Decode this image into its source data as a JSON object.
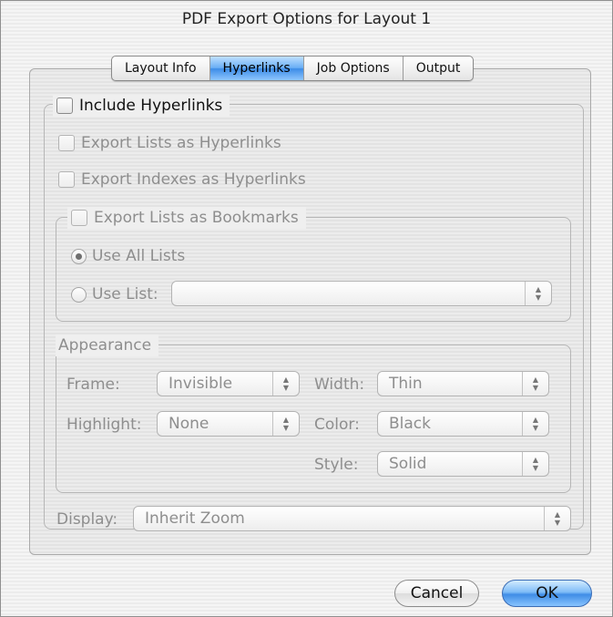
{
  "window": {
    "title": "PDF Export Options for Layout 1"
  },
  "tabs": [
    {
      "label": "Layout Info",
      "active": false
    },
    {
      "label": "Hyperlinks",
      "active": true
    },
    {
      "label": "Job Options",
      "active": false
    },
    {
      "label": "Output",
      "active": false
    }
  ],
  "hyperlinks": {
    "include_label": "Include Hyperlinks",
    "include_checked": false,
    "export_lists_hyperlinks": {
      "label": "Export Lists as Hyperlinks",
      "checked": false,
      "enabled": false
    },
    "export_indexes_hyperlinks": {
      "label": "Export Indexes as Hyperlinks",
      "checked": false,
      "enabled": false
    },
    "bookmarks": {
      "label": "Export Lists as Bookmarks",
      "checked": false,
      "use_all_lists": {
        "label": "Use All Lists",
        "selected": true
      },
      "use_list": {
        "label": "Use List:",
        "selected": false,
        "value": ""
      }
    },
    "appearance": {
      "legend": "Appearance",
      "frame_label": "Frame:",
      "frame_value": "Invisible",
      "highlight_label": "Highlight:",
      "highlight_value": "None",
      "width_label": "Width:",
      "width_value": "Thin",
      "color_label": "Color:",
      "color_value": "Black",
      "style_label": "Style:",
      "style_value": "Solid"
    },
    "display_label": "Display:",
    "display_value": "Inherit Zoom"
  },
  "buttons": {
    "cancel": "Cancel",
    "ok": "OK"
  },
  "colors": {
    "accent": "#3d8ce7",
    "disabled_text": "#8e8e8e"
  },
  "icons": {
    "popup_arrows": "up-down-arrows-icon"
  }
}
